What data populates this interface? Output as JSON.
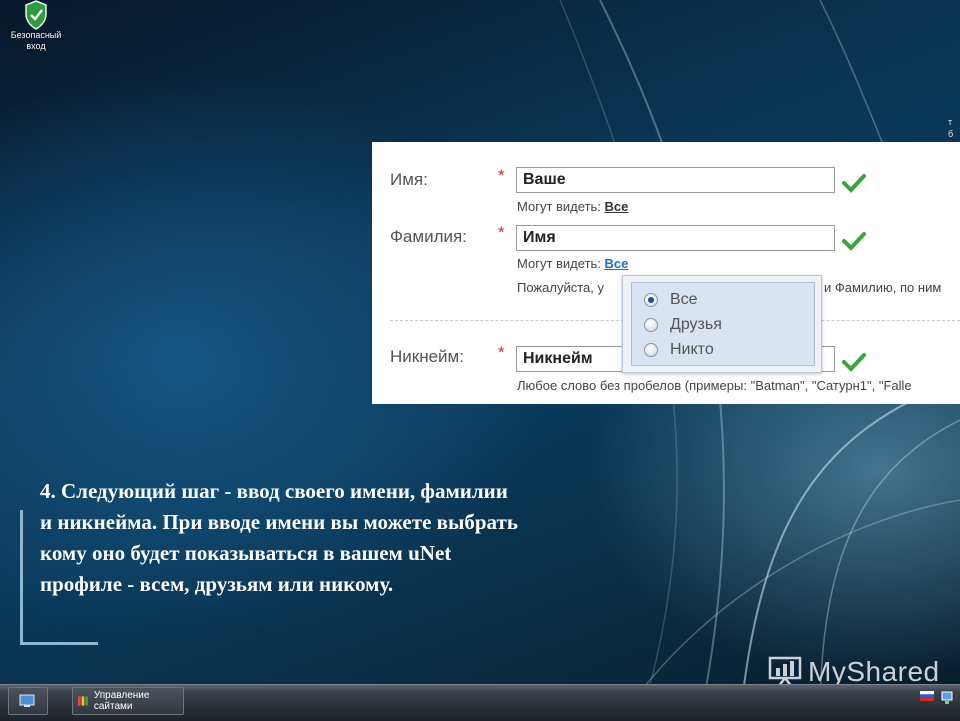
{
  "desktop": {
    "icon_label": "Безопасный вход",
    "right_edge_text": "т бо"
  },
  "form": {
    "fields": [
      {
        "label": "Имя:",
        "required_mark": "*",
        "value": "Ваше",
        "hint_prefix": "Могут видеть:",
        "hint_link": "Все"
      },
      {
        "label": "Фамилия:",
        "required_mark": "*",
        "value": "Имя",
        "hint_prefix": "Могут видеть:",
        "hint_link": "Все"
      }
    ],
    "note_left": "Пожалуйста, у",
    "note_right": "и Фамилию, по ним",
    "nickname": {
      "label": "Никнейм:",
      "required_mark": "*",
      "value": "Никнейм",
      "hint": "Любое слово без пробелов (примеры: \"Batman\", \"Сатурн1\", \"Falle"
    },
    "visibility_popup": {
      "options": [
        "Все",
        "Друзья",
        "Никто"
      ],
      "selected_index": 0
    }
  },
  "caption": {
    "text": "4. Следующий шаг - ввод своего имени, фамилии и никнейма. При вводе имени вы можете выбрать кому оно будет показываться в вашем uNet профиле - всем, друзьям или никому."
  },
  "watermark": {
    "text": "MyShared"
  },
  "taskbar": {
    "task_label": "Управление сайтами"
  },
  "colors": {
    "check_green": "#3aa63a",
    "link_blue": "#1d6fb8",
    "required_red": "#c0392b"
  }
}
